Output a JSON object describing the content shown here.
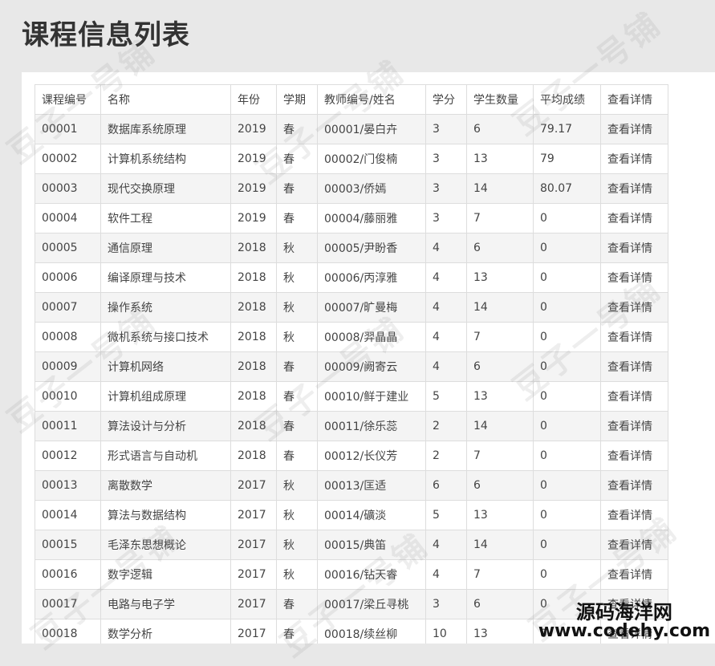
{
  "page": {
    "title": "课程信息列表"
  },
  "table": {
    "headers": [
      "课程编号",
      "名称",
      "年份",
      "学期",
      "教师编号/姓名",
      "学分",
      "学生数量",
      "平均成绩",
      "查看详情"
    ],
    "rows": [
      [
        "00001",
        "数据库系统原理",
        "2019",
        "春",
        "00001/晏白卉",
        "3",
        "6",
        "79.17",
        "查看详情"
      ],
      [
        "00002",
        "计算机系统结构",
        "2019",
        "春",
        "00002/门俊楠",
        "3",
        "13",
        "79",
        "查看详情"
      ],
      [
        "00003",
        "现代交换原理",
        "2019",
        "春",
        "00003/侨嫣",
        "3",
        "14",
        "80.07",
        "查看详情"
      ],
      [
        "00004",
        "软件工程",
        "2019",
        "春",
        "00004/藤丽雅",
        "3",
        "7",
        "0",
        "查看详情"
      ],
      [
        "00005",
        "通信原理",
        "2018",
        "秋",
        "00005/尹盼香",
        "4",
        "6",
        "0",
        "查看详情"
      ],
      [
        "00006",
        "编译原理与技术",
        "2018",
        "秋",
        "00006/丙淳雅",
        "4",
        "13",
        "0",
        "查看详情"
      ],
      [
        "00007",
        "操作系统",
        "2018",
        "秋",
        "00007/旷曼梅",
        "4",
        "14",
        "0",
        "查看详情"
      ],
      [
        "00008",
        "微机系统与接口技术",
        "2018",
        "秋",
        "00008/羿晶晶",
        "4",
        "7",
        "0",
        "查看详情"
      ],
      [
        "00009",
        "计算机网络",
        "2018",
        "春",
        "00009/阙寄云",
        "4",
        "6",
        "0",
        "查看详情"
      ],
      [
        "00010",
        "计算机组成原理",
        "2018",
        "春",
        "00010/鲜于建业",
        "5",
        "13",
        "0",
        "查看详情"
      ],
      [
        "00011",
        "算法设计与分析",
        "2018",
        "春",
        "00011/徐乐蕊",
        "2",
        "14",
        "0",
        "查看详情"
      ],
      [
        "00012",
        "形式语言与自动机",
        "2018",
        "春",
        "00012/长仪芳",
        "2",
        "7",
        "0",
        "查看详情"
      ],
      [
        "00013",
        "离散数学",
        "2017",
        "秋",
        "00013/匡适",
        "6",
        "6",
        "0",
        "查看详情"
      ],
      [
        "00014",
        "算法与数据结构",
        "2017",
        "秋",
        "00014/礦淡",
        "5",
        "13",
        "0",
        "查看详情"
      ],
      [
        "00015",
        "毛泽东思想概论",
        "2017",
        "秋",
        "00015/典笛",
        "4",
        "14",
        "0",
        "查看详情"
      ],
      [
        "00016",
        "数字逻辑",
        "2017",
        "秋",
        "00016/钻天睿",
        "4",
        "7",
        "0",
        "查看详情"
      ],
      [
        "00017",
        "电路与电子学",
        "2017",
        "春",
        "00017/梁丘寻桃",
        "3",
        "6",
        "0",
        "查看详情"
      ],
      [
        "00018",
        "数学分析",
        "2017",
        "春",
        "00018/续丝柳",
        "10",
        "13",
        "0",
        "查看详情"
      ]
    ]
  },
  "watermark": {
    "text": "豆子一号铺"
  },
  "brand": {
    "cn": "源码海洋网",
    "en": "www.codehy.com"
  }
}
